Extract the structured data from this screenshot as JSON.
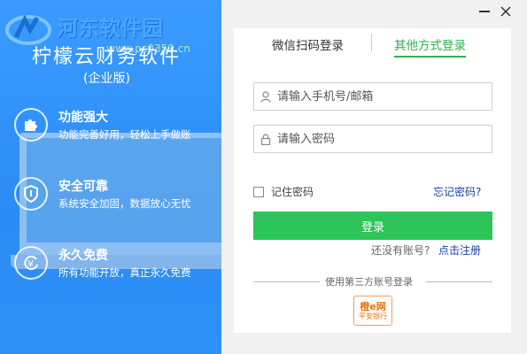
{
  "watermark": {
    "site_name": "河东软件园",
    "url": "www.pc0359.cn"
  },
  "app": {
    "title": "柠檬云财务软件",
    "edition": "(企业版)"
  },
  "features": [
    {
      "icon": "puzzle-icon",
      "title": "功能强大",
      "desc": "功能完善好用，轻松上手做账"
    },
    {
      "icon": "shield-icon",
      "title": "安全可靠",
      "desc": "系统安全加固，数据放心无忧"
    },
    {
      "icon": "yen-cycle-icon",
      "title": "永久免费",
      "desc": "所有功能开放，真正永久免费"
    }
  ],
  "tabs": {
    "wechat": "微信扫码登录",
    "other": "其他方式登录"
  },
  "login": {
    "phone_placeholder": "请输入手机号/邮箱",
    "phone_value": "",
    "password_placeholder": "请输入密码",
    "password_value": "",
    "remember_label": "记住密码",
    "forgot_label": "忘记密码?",
    "button_label": "登录",
    "no_account": "还没有账号?",
    "register_label": "点击注册",
    "third_party_label": "使用第三方账号登录"
  },
  "third_party": {
    "name_line1": "橙e网",
    "name_line2": "平安银行"
  },
  "colors": {
    "brand_blue": "#3a9bff",
    "accent_green": "#2dc45a",
    "link_blue": "#1a3fa8"
  }
}
